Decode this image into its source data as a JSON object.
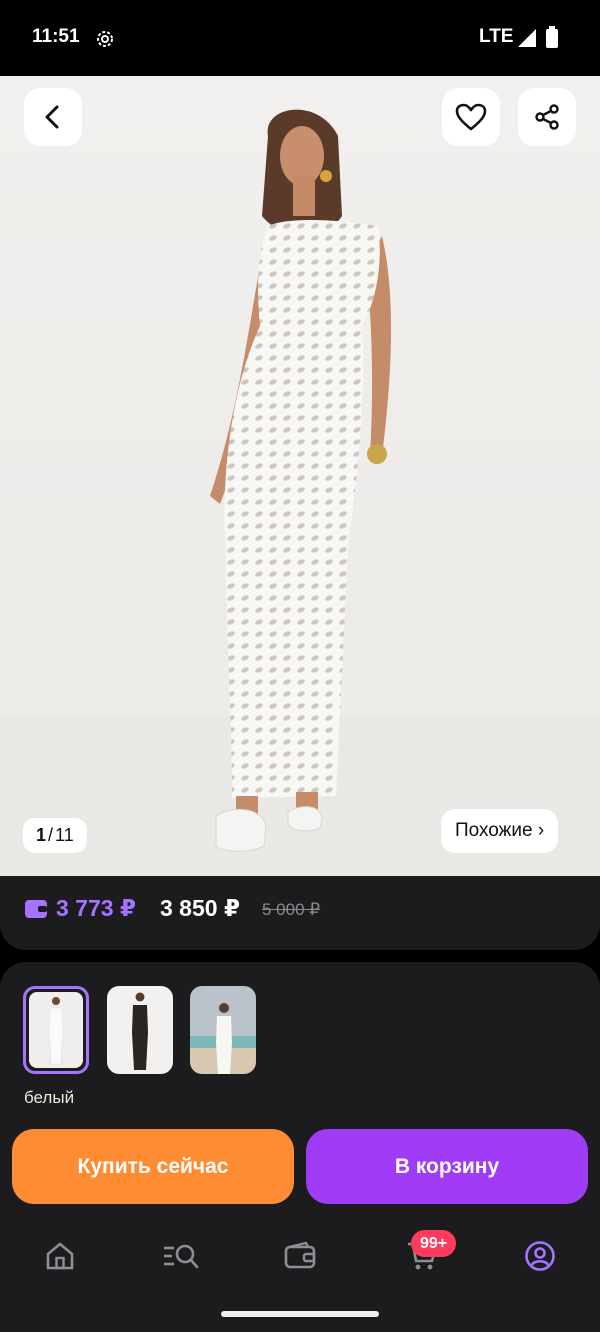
{
  "status_bar": {
    "time": "11:51",
    "network": "LTE",
    "icons": [
      "settings-gear-icon",
      "signal-icon",
      "battery-icon"
    ]
  },
  "product": {
    "image_counter": {
      "current": "1",
      "total": "11",
      "separator": "/"
    },
    "similar_label": "Похожие ›",
    "top_actions": [
      "back-arrow-icon",
      "heart-icon",
      "share-icon"
    ]
  },
  "prices": {
    "wallet_price": "3 773 ₽",
    "price": "3 850 ₽",
    "old_price": "5 000 ₽",
    "wallet_color": "#a574ff"
  },
  "variants": {
    "selected_color": "белый",
    "swatches": [
      "white-dress",
      "black-dress",
      "white-dress-beach"
    ]
  },
  "actions": {
    "buy_now": "Купить сейчас",
    "add_to_cart": "В корзину",
    "buy_color": "#ff8c32",
    "cart_color": "#a03cf5"
  },
  "bottom_nav": {
    "items": [
      "home-icon",
      "catalog-search-icon",
      "wallet-icon",
      "cart-icon",
      "profile-icon"
    ],
    "cart_badge": "99+",
    "active": "profile-icon"
  }
}
